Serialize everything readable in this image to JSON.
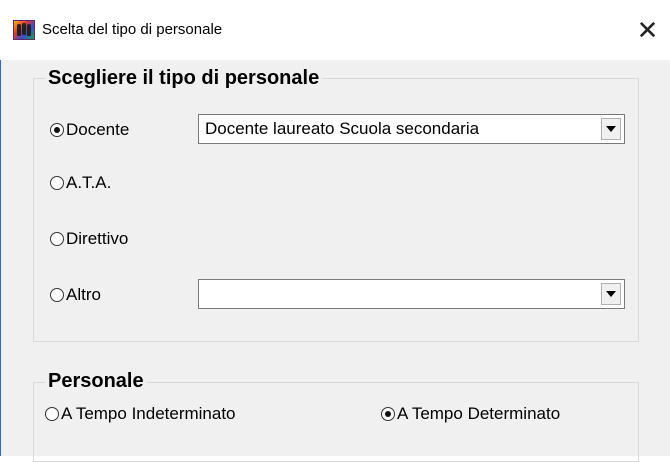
{
  "window": {
    "title": "Scelta del tipo di personale",
    "close_glyph": "✕",
    "icon": "app-people-icon"
  },
  "group_tipo": {
    "title": "Scegliere il tipo di personale",
    "options": [
      {
        "label": "Docente",
        "checked": true
      },
      {
        "label": "A.T.A.",
        "checked": false
      },
      {
        "label": "Direttivo",
        "checked": false
      },
      {
        "label": "Altro",
        "checked": false
      }
    ],
    "docente_combo_value": "Docente laureato Scuola secondaria",
    "altro_combo_value": ""
  },
  "group_personale": {
    "title": "Personale",
    "options": [
      {
        "label": "A Tempo Indeterminato",
        "checked": false
      },
      {
        "label": "A Tempo Determinato",
        "checked": true
      }
    ]
  }
}
